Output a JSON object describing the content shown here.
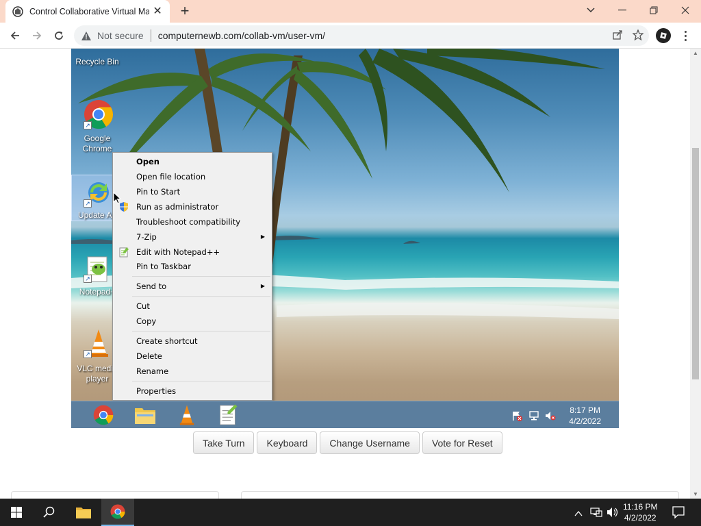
{
  "browser": {
    "tab_title": "Control Collaborative Virtual Machines",
    "close_tab": "✕",
    "new_tab": "+",
    "not_secure": "Not secure",
    "url": "computernewb.com/collab-vm/user-vm/"
  },
  "vm": {
    "desktop_icons": [
      {
        "label": "Recycle Bin",
        "icon": "recycle-bin-icon"
      },
      {
        "label": "Google Chrome",
        "icon": "chrome-icon"
      },
      {
        "label": "Update Ap",
        "icon": "update-icon"
      },
      {
        "label": "Notepad+",
        "icon": "notepad-plus-icon"
      },
      {
        "label": "VLC media player",
        "icon": "vlc-icon"
      }
    ],
    "context_menu": [
      {
        "label": "Open",
        "bold": true
      },
      {
        "label": "Open file location"
      },
      {
        "label": "Pin to Start"
      },
      {
        "label": "Run as administrator",
        "icon": "shield-icon"
      },
      {
        "label": "Troubleshoot compatibility"
      },
      {
        "label": "7-Zip",
        "submenu": true
      },
      {
        "label": "Edit with Notepad++",
        "icon": "notepad-icon"
      },
      {
        "label": "Pin to Taskbar"
      },
      {
        "label": "Send to",
        "submenu": true
      },
      {
        "label": "Cut"
      },
      {
        "label": "Copy"
      },
      {
        "label": "Create shortcut"
      },
      {
        "label": "Delete"
      },
      {
        "label": "Rename"
      },
      {
        "label": "Properties"
      }
    ],
    "taskbar_apps": [
      "chrome-icon",
      "file-explorer-icon",
      "vlc-icon",
      "notepad-plus-icon"
    ],
    "time": "8:17 PM",
    "date": "4/2/2022"
  },
  "controls": {
    "take_turn": "Take Turn",
    "keyboard": "Keyboard",
    "change_username": "Change Username",
    "vote_reset": "Vote for Reset"
  },
  "host_taskbar": {
    "time": "11:16 PM",
    "date": "4/2/2022"
  },
  "colors": {
    "tabbar": "#fbd9c9",
    "vm_taskbar": "#5b7e9e",
    "windows_taskbar": "#1f1f1f"
  }
}
